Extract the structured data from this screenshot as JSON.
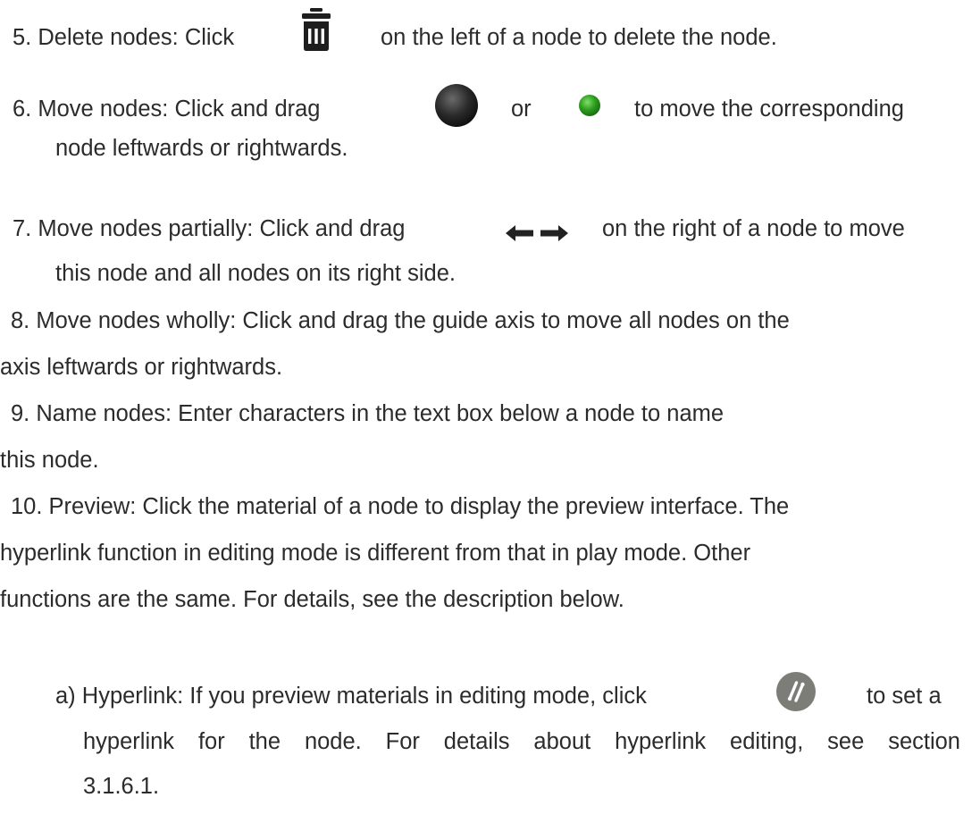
{
  "items": [
    {
      "id": "5",
      "number": "5.",
      "label": "Delete nodes:",
      "before_icon": "Click",
      "icon": "trash-icon",
      "after_icon": "on the left of a node to delete the node."
    },
    {
      "id": "6",
      "number": "6.",
      "label": "Move nodes:",
      "before_icon": "Click and drag",
      "icon1": "dark-circle-handle-icon",
      "between": "or",
      "icon2": "green-dot-handle-icon",
      "after_icon": "to move the corresponding",
      "continuation": "node leftwards or rightwards."
    },
    {
      "id": "7",
      "number": "7.",
      "label": "Move nodes partially:",
      "before_icon": "Click and drag",
      "icon": "double-arrow-icon",
      "after_icon": "on the right of a node to move",
      "continuation": "this node and all nodes on its right side."
    },
    {
      "id": "8",
      "number": "8.",
      "text": "Move nodes wholly: Click and drag the guide axis to move all nodes on the",
      "continuation": "axis leftwards or rightwards."
    },
    {
      "id": "9",
      "number": "9.",
      "text": "Name nodes: Enter characters in the text box below a node to name",
      "continuation": "this node."
    },
    {
      "id": "10",
      "number": "10.",
      "text": "Preview: Click the material of a node to display the preview interface. The",
      "line2": "hyperlink function in editing mode is different from that in play mode. Other",
      "line3": "functions are the same. For details, see the description below."
    }
  ],
  "subitem": {
    "marker": "a)",
    "before_icon": "Hyperlink: If you preview materials in editing mode, click",
    "icon": "hyperlink-icon",
    "after_icon": "to set a",
    "line2": "hyperlink for the node. For details about hyperlink editing, see section",
    "line3": "3.1.6.1."
  },
  "colors": {
    "text": "#2b2b2b",
    "trash": "#1e1e1e",
    "green": "#2e9e1e",
    "hyperlink_bg": "#7d7d78"
  }
}
